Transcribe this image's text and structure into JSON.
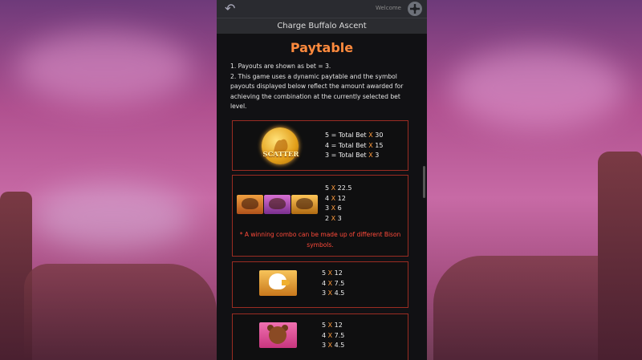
{
  "header": {
    "back_icon": "arrow-left-icon",
    "welcome_label": "Welcome",
    "avatar_icon": "user-avatar-icon",
    "game_title": "Charge Buffalo Ascent"
  },
  "paytable": {
    "heading": "Paytable",
    "notes": [
      "1. Payouts are shown as bet = 3.",
      "2. This game uses a dynamic paytable and the symbol payouts displayed below reflect the amount awarded for achieving the combination at the currently selected bet level."
    ],
    "scatter": {
      "label": "SCATTER",
      "payouts": [
        {
          "count": "5",
          "sep": " = ",
          "text": "Total Bet",
          "x": " X ",
          "value": "30"
        },
        {
          "count": "4",
          "sep": " = ",
          "text": "Total Bet",
          "x": " X ",
          "value": "15"
        },
        {
          "count": "3",
          "sep": " = ",
          "text": "Total Bet",
          "x": " X ",
          "value": "3"
        }
      ]
    },
    "bison": {
      "payouts": [
        {
          "count": "5",
          "x": " X ",
          "value": "22.5"
        },
        {
          "count": "4",
          "x": " X ",
          "value": "12"
        },
        {
          "count": "3",
          "x": " X ",
          "value": "6"
        },
        {
          "count": "2",
          "x": " X ",
          "value": "3"
        }
      ],
      "note": "* A winning combo can be made up of different Bison symbols."
    },
    "eagle": {
      "payouts": [
        {
          "count": "5",
          "x": " X ",
          "value": "12"
        },
        {
          "count": "4",
          "x": " X ",
          "value": "7.5"
        },
        {
          "count": "3",
          "x": " X ",
          "value": "4.5"
        }
      ]
    },
    "bear": {
      "payouts": [
        {
          "count": "5",
          "x": " X ",
          "value": "12"
        },
        {
          "count": "4",
          "x": " X ",
          "value": "7.5"
        },
        {
          "count": "3",
          "x": " X ",
          "value": "4.5"
        }
      ]
    }
  }
}
